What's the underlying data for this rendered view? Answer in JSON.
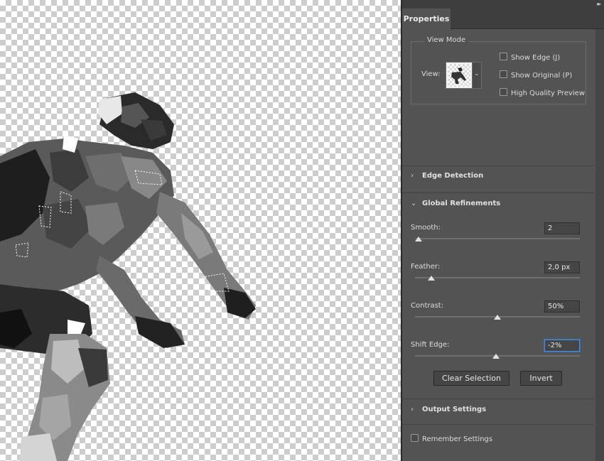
{
  "panel": {
    "tab_label": "Properties",
    "collapse_icon": "double-chevron-right-icon"
  },
  "view_mode": {
    "title": "View Mode",
    "view_label": "View:",
    "options": [
      {
        "label": "Show Edge (J)",
        "checked": false
      },
      {
        "label": "Show Original (P)",
        "checked": false
      },
      {
        "label": "High Quality Preview",
        "checked": false
      }
    ]
  },
  "sections": {
    "edge_detection": "Edge Detection",
    "global_refinements": "Global Refinements",
    "output_settings": "Output Settings"
  },
  "sliders": {
    "smooth": {
      "label": "Smooth:",
      "value": "2",
      "fraction": 0.02
    },
    "feather": {
      "label": "Feather:",
      "value": "2,0 px",
      "fraction": 0.1
    },
    "contrast": {
      "label": "Contrast:",
      "value": "50%",
      "fraction": 0.5
    },
    "shift_edge": {
      "label": "Shift Edge:",
      "value": "-2%",
      "fraction": 0.49
    }
  },
  "buttons": {
    "clear_selection": "Clear Selection",
    "invert": "Invert"
  },
  "remember": {
    "label": "Remember Settings",
    "checked": false
  },
  "colors": {
    "panel_bg": "#535353",
    "focus_blue": "#4b8ad9"
  }
}
